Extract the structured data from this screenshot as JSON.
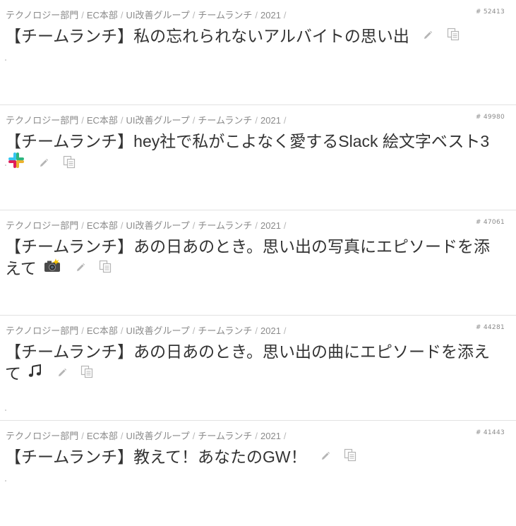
{
  "colors": {
    "text": "#333333",
    "muted": "#8a8a8a",
    "divider": "#e2e2e2",
    "icon": "#b5b5b5"
  },
  "posts": [
    {
      "breadcrumb": [
        "テクノロジー部門",
        "EC本部",
        "UI改善グループ",
        "チームランチ",
        "2021"
      ],
      "id": "# 52413",
      "title": "【チームランチ】私の忘れられないアルバイトの思い出",
      "emoji": null
    },
    {
      "breadcrumb": [
        "テクノロジー部門",
        "EC本部",
        "UI改善グループ",
        "チームランチ",
        "2021"
      ],
      "id": "# 49980",
      "title": "【チームランチ】hey社で私がこよなく愛するSlack 絵文字ベスト3",
      "emoji": "slack-logo-icon"
    },
    {
      "breadcrumb": [
        "テクノロジー部門",
        "EC本部",
        "UI改善グループ",
        "チームランチ",
        "2021"
      ],
      "id": "# 47061",
      "title": "【チームランチ】あの日あのとき。思い出の写真にエピソードを添えて",
      "emoji": "camera-flash-icon"
    },
    {
      "breadcrumb": [
        "テクノロジー部門",
        "EC本部",
        "UI改善グループ",
        "チームランチ",
        "2021"
      ],
      "id": "# 44281",
      "title": "【チームランチ】あの日あのとき。思い出の曲にエピソードを添えて",
      "emoji": "musical-notes-icon"
    },
    {
      "breadcrumb": [
        "テクノロジー部門",
        "EC本部",
        "UI改善グループ",
        "チームランチ",
        "2021"
      ],
      "id": "# 41443",
      "title": "【チームランチ】教えて！あなたのGW！",
      "emoji": null
    }
  ]
}
